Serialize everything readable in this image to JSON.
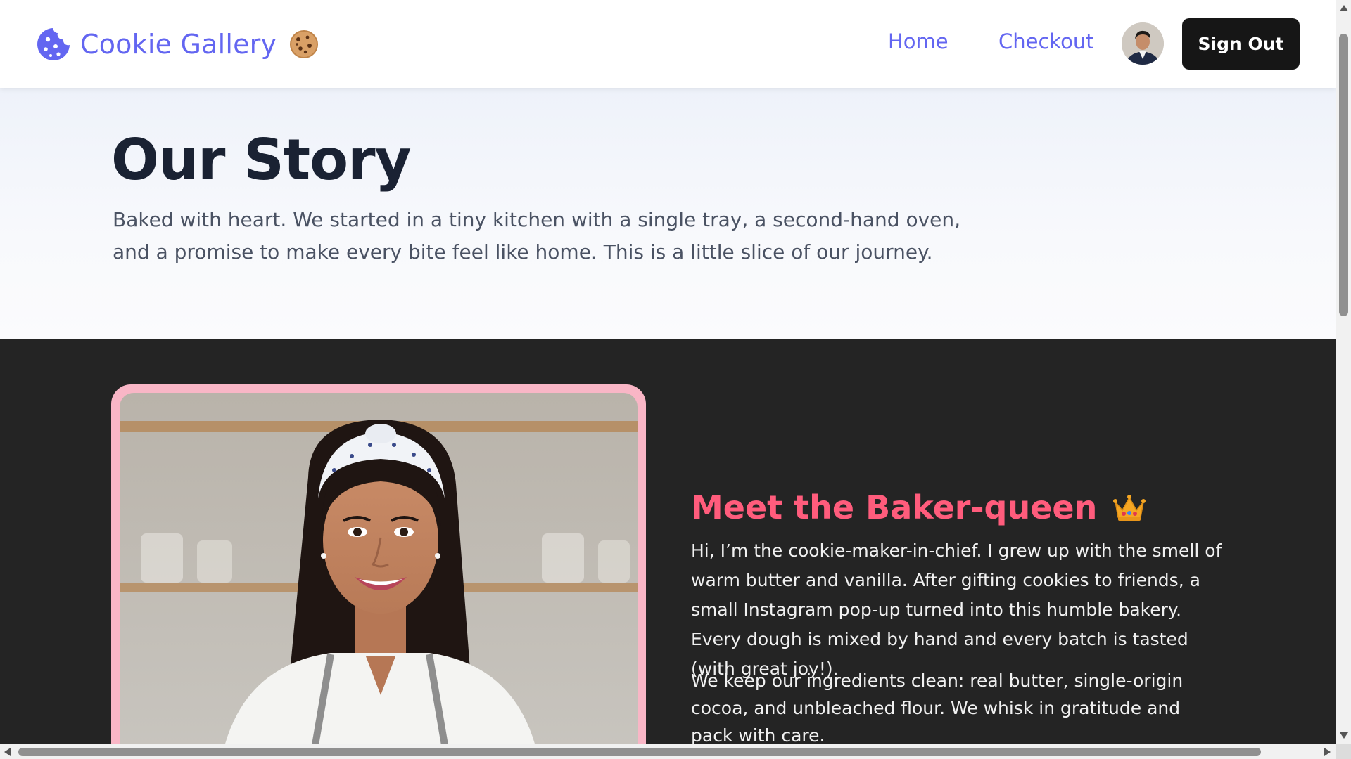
{
  "header": {
    "brand_name": "Cookie Gallery",
    "brand_icon": "cookie-icon",
    "brand_emoji": "cookie-emoji",
    "nav": [
      {
        "label": "Home"
      },
      {
        "label": "Checkout"
      }
    ],
    "avatar": "user-avatar",
    "sign_out_label": "Sign Out"
  },
  "hero": {
    "title": "Our Story",
    "description": "Baked with heart. We started in a tiny kitchen with a single tray, a second-hand oven, and a promise to make every bite feel like home. This is a little slice of our journey."
  },
  "baker": {
    "title": "Meet the Baker-queen",
    "title_icon": "crown-icon",
    "paragraph1": "Hi, I’m the cookie-maker-in-chief. I grew up with the smell of warm butter and vanilla. After gifting cookies to friends, a small Instagram pop-up turned into this humble bakery. Every dough is mixed by hand and every batch is tasted (with great joy!).",
    "paragraph2": "We keep our ingredients clean: real butter, single-origin cocoa, and unbleached flour. We whisk in gratitude and pack with care."
  },
  "colors": {
    "accent": "#6366f1",
    "baker_title": "#ff5c7c",
    "dark_bg": "#242424",
    "photo_frame": "#f9b6c6",
    "button_bg": "#161616"
  }
}
